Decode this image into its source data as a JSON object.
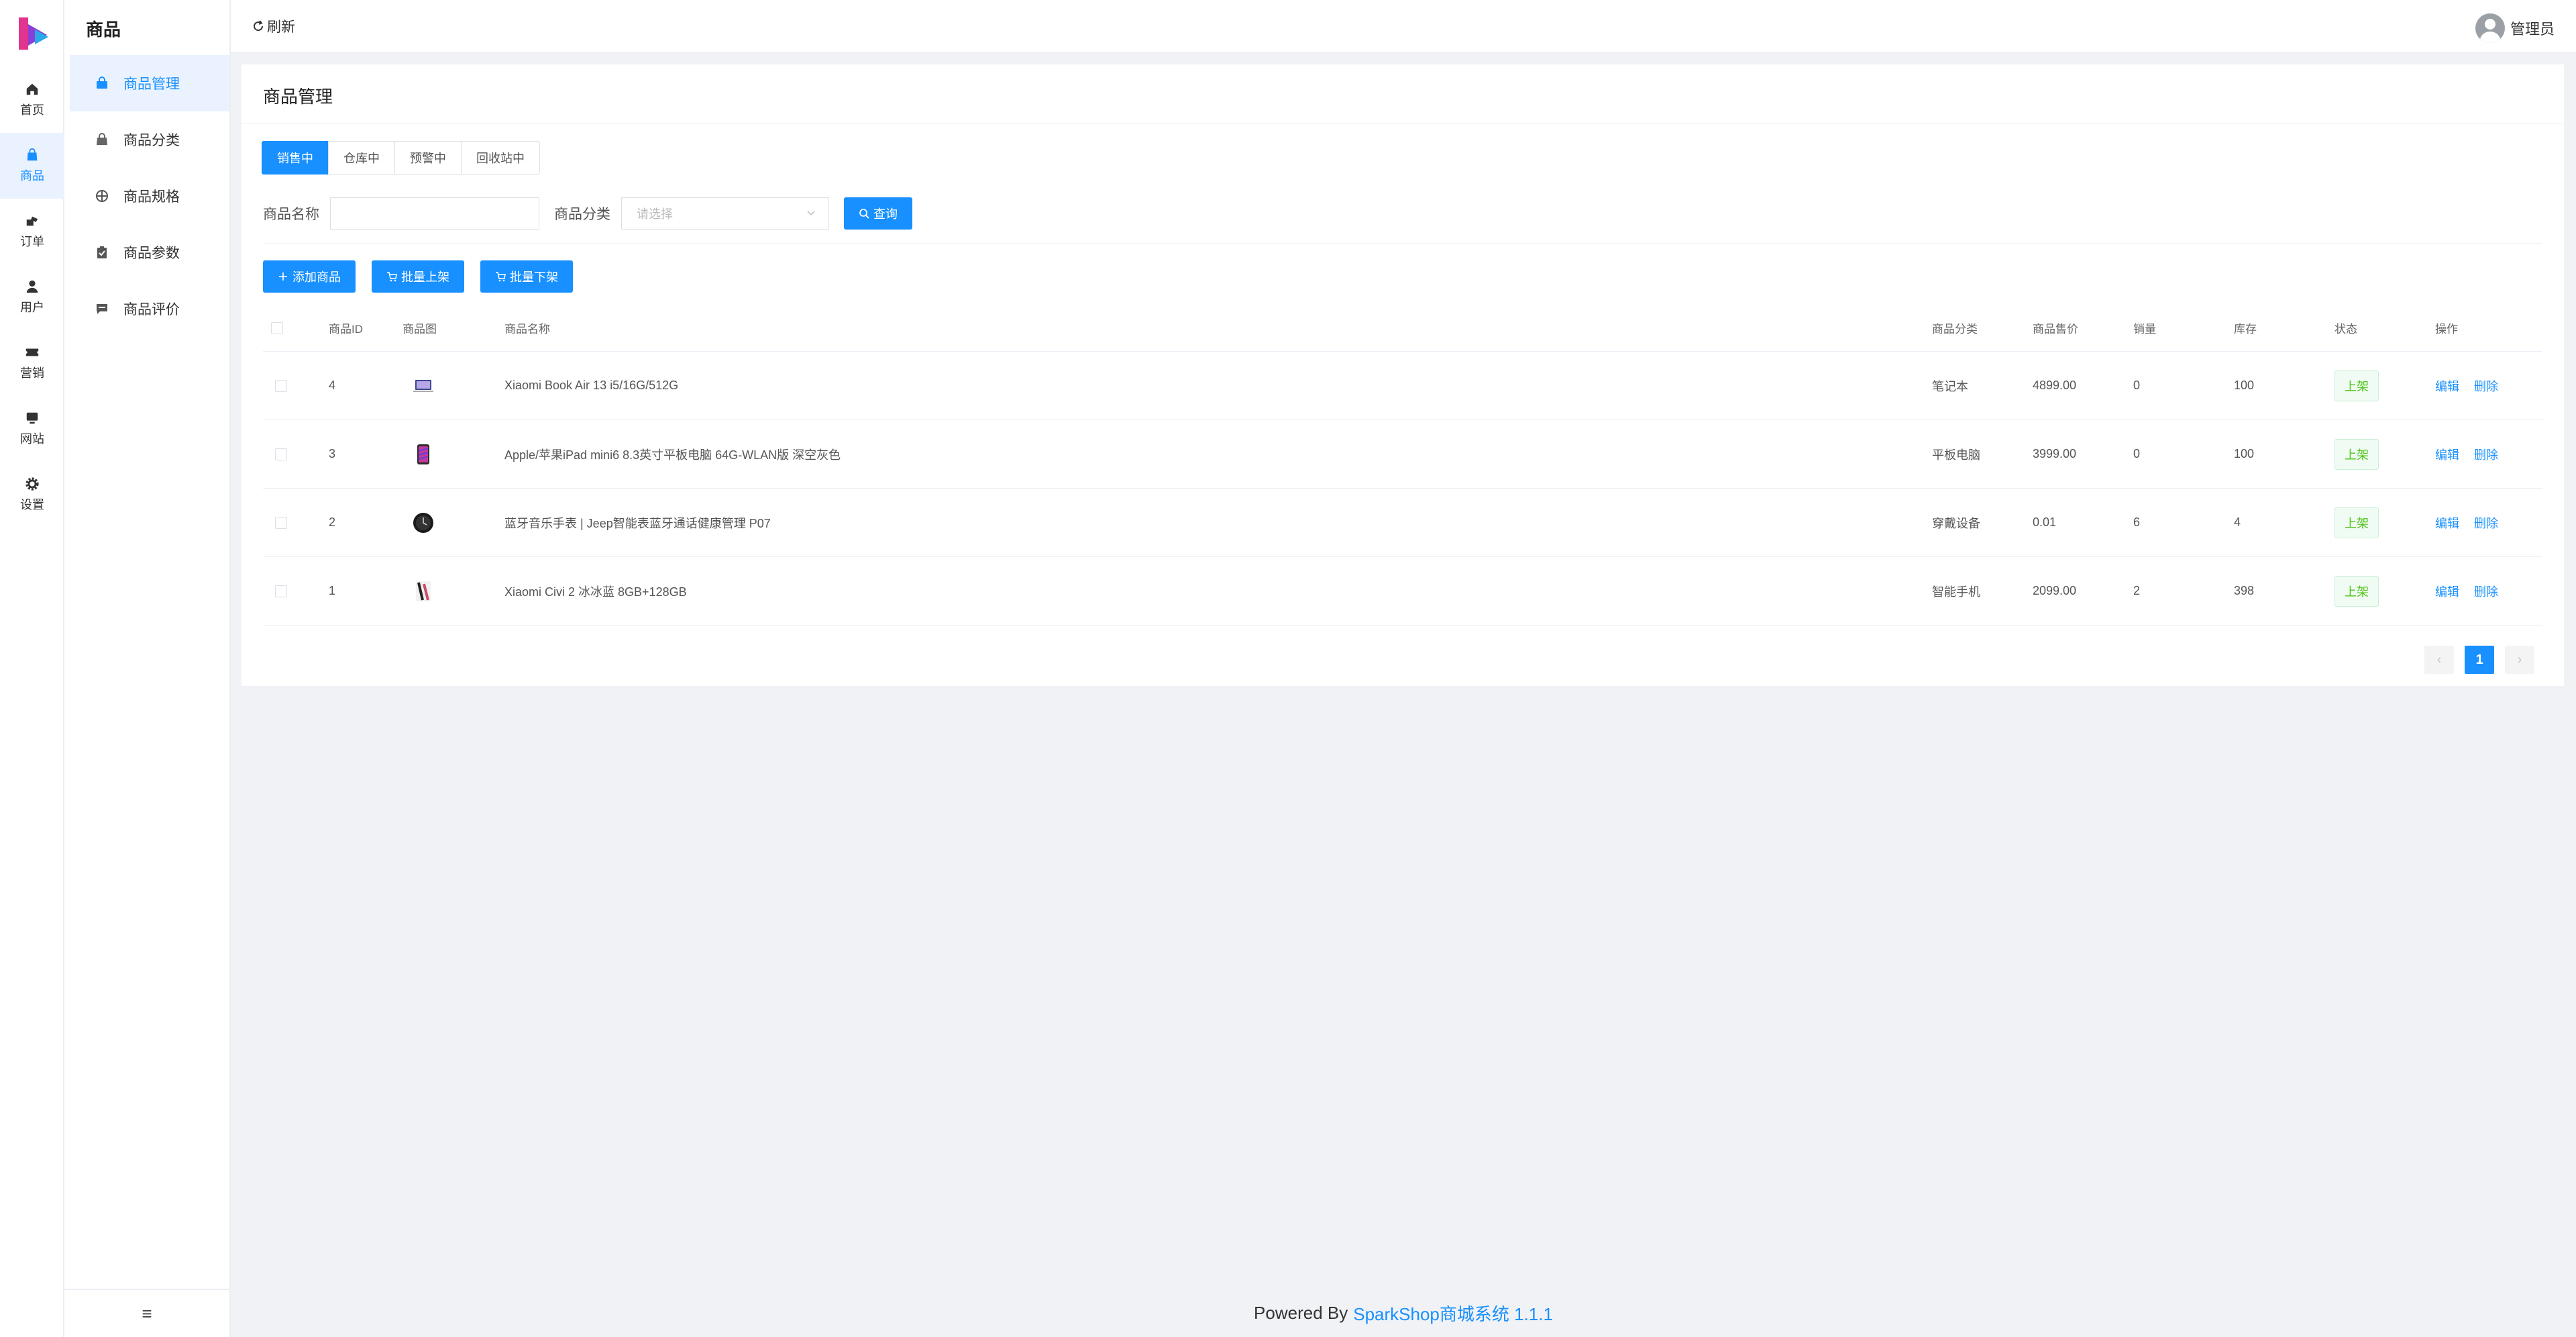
{
  "app": {
    "brand_colors": {
      "accent": "#1890ff",
      "success": "#52c41a"
    }
  },
  "rail": {
    "items": [
      {
        "label": "首页",
        "icon": "home-icon"
      },
      {
        "label": "商品",
        "icon": "bag-icon",
        "active": true
      },
      {
        "label": "订单",
        "icon": "order-icon"
      },
      {
        "label": "用户",
        "icon": "user-icon"
      },
      {
        "label": "营销",
        "icon": "ticket-icon"
      },
      {
        "label": "网站",
        "icon": "monitor-icon"
      },
      {
        "label": "设置",
        "icon": "gear-icon"
      }
    ]
  },
  "submenu": {
    "title": "商品",
    "items": [
      {
        "label": "商品管理",
        "icon": "shopping-bag-icon",
        "active": true
      },
      {
        "label": "商品分类",
        "icon": "bag-icon"
      },
      {
        "label": "商品规格",
        "icon": "target-icon"
      },
      {
        "label": "商品参数",
        "icon": "clipboard-icon"
      },
      {
        "label": "商品评价",
        "icon": "comment-icon"
      }
    ],
    "collapse_icon": "≡"
  },
  "header": {
    "refresh_label": "刷新",
    "user_name": "管理员"
  },
  "card": {
    "title": "商品管理",
    "tabs": [
      "销售中",
      "仓库中",
      "预警中",
      "回收站中"
    ],
    "filters": {
      "name_label": "商品名称",
      "name_value": "",
      "category_label": "商品分类",
      "category_placeholder": "请选择",
      "search_label": "查询"
    },
    "actions": {
      "add": "添加商品",
      "batch_on": "批量上架",
      "batch_off": "批量下架"
    }
  },
  "table": {
    "columns": [
      "商品ID",
      "商品图",
      "商品名称",
      "商品分类",
      "商品售价",
      "销量",
      "库存",
      "状态",
      "操作"
    ],
    "rows": [
      {
        "id": "4",
        "image": "laptop-thumb",
        "name": "Xiaomi Book Air 13 i5/16G/512G",
        "category": "笔记本",
        "price": "4899.00",
        "sales": "0",
        "stock": "100",
        "status": "上架",
        "edit": "编辑",
        "delete": "删除"
      },
      {
        "id": "3",
        "image": "tablet-thumb",
        "name": "Apple/苹果iPad mini6 8.3英寸平板电脑 64G-WLAN版 深空灰色",
        "category": "平板电脑",
        "price": "3999.00",
        "sales": "0",
        "stock": "100",
        "status": "上架",
        "edit": "编辑",
        "delete": "删除"
      },
      {
        "id": "2",
        "image": "watch-thumb",
        "name": "蓝牙音乐手表 | Jeep智能表蓝牙通话健康管理 P07",
        "category": "穿戴设备",
        "price": "0.01",
        "sales": "6",
        "stock": "4",
        "status": "上架",
        "edit": "编辑",
        "delete": "删除"
      },
      {
        "id": "1",
        "image": "phone-thumb",
        "name": "Xiaomi Civi 2 冰冰蓝 8GB+128GB",
        "category": "智能手机",
        "price": "2099.00",
        "sales": "2",
        "stock": "398",
        "status": "上架",
        "edit": "编辑",
        "delete": "删除"
      }
    ]
  },
  "pagination": {
    "prev": "‹",
    "current": "1",
    "next": "›"
  },
  "footer": {
    "prefix": "Powered By",
    "brand": "SparkShop商城系统 1.1.1"
  }
}
